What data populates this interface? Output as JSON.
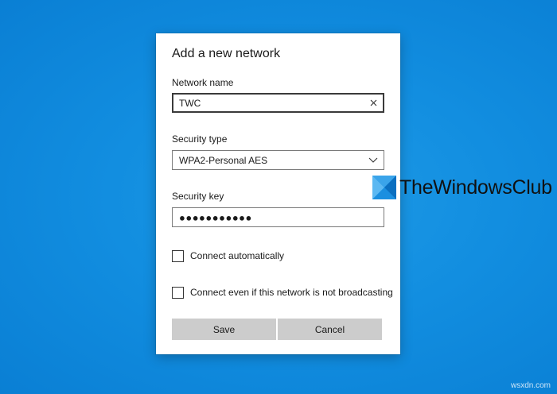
{
  "dialog": {
    "title": "Add a new network",
    "network_name": {
      "label": "Network name",
      "value": "TWC"
    },
    "security_type": {
      "label": "Security type",
      "selected": "WPA2-Personal AES"
    },
    "security_key": {
      "label": "Security key",
      "masked_value": "●●●●●●●●●●●"
    },
    "options": [
      {
        "label": "Connect automatically",
        "checked": false
      },
      {
        "label": "Connect even if this network is not broadcasting",
        "checked": false
      }
    ],
    "buttons": {
      "save": "Save",
      "cancel": "Cancel"
    }
  },
  "watermark": {
    "text": "TheWindowsClub",
    "logo_colors": [
      "#1a8fe0",
      "#5bb8f2",
      "#0a6fc0",
      "#3aa4ea"
    ]
  },
  "site_credit": "wsxdn.com",
  "colors": {
    "desktop": "#128ee0",
    "button": "#cccccc",
    "border": "#7a7a7a"
  },
  "icons": {
    "clear": "close-icon",
    "dropdown": "chevron-down-icon"
  }
}
